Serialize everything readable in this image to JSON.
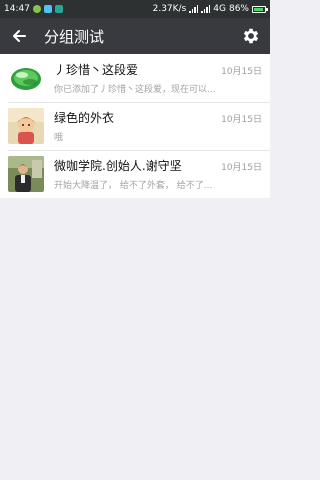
{
  "status_bar": {
    "time": "14:47",
    "speed": "2.37K/s",
    "network": "4G",
    "battery": "86%",
    "battery_level": 0.86
  },
  "header": {
    "title": "分组测试"
  },
  "conversations": [
    {
      "name": "丿珍惜丶这段爱",
      "date": "10月15日",
      "preview": "你已添加了丿珍惜丶这段爱，现在可以..."
    },
    {
      "name": "绿色的外衣",
      "date": "10月15日",
      "preview": "哦"
    },
    {
      "name": "微咖学院.创始人.谢守坚",
      "date": "10月15日",
      "preview": "开始大降温了， 给不了外套， 给不了..."
    }
  ],
  "colors": {
    "status_bar": "#2e3132",
    "title_bar": "#393a3f",
    "background": "#efeff4"
  }
}
